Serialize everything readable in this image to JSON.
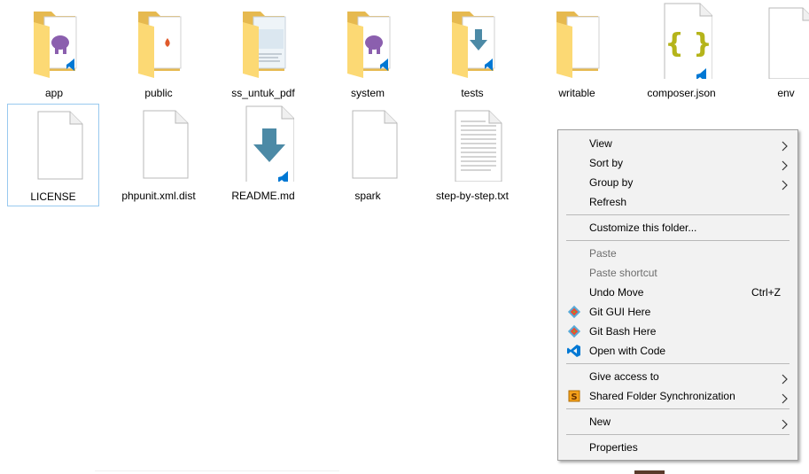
{
  "files": [
    {
      "name": "app",
      "type": "folder",
      "overlay": "elephant-vscode"
    },
    {
      "name": "public",
      "type": "folder",
      "overlay": "flame"
    },
    {
      "name": "ss_untuk_pdf",
      "type": "folder",
      "overlay": "screenshot"
    },
    {
      "name": "system",
      "type": "folder",
      "overlay": "elephant-vscode"
    },
    {
      "name": "tests",
      "type": "folder",
      "overlay": "download-vscode"
    },
    {
      "name": "writable",
      "type": "folder",
      "overlay": "blank-page"
    },
    {
      "name": "composer.json",
      "type": "file",
      "overlay": "json-braces-vscode"
    },
    {
      "name": "env",
      "type": "file",
      "overlay": "none"
    },
    {
      "name": "LICENSE",
      "type": "file",
      "overlay": "none",
      "selected": true
    },
    {
      "name": "phpunit.xml.dist",
      "type": "file",
      "overlay": "none"
    },
    {
      "name": "README.md",
      "type": "file",
      "overlay": "download-vscode"
    },
    {
      "name": "spark",
      "type": "file",
      "overlay": "none"
    },
    {
      "name": "step-by-step.txt",
      "type": "file",
      "overlay": "text-lines"
    }
  ],
  "context_menu": {
    "items": [
      {
        "label": "View",
        "submenu": true
      },
      {
        "label": "Sort by",
        "submenu": true
      },
      {
        "label": "Group by",
        "submenu": true
      },
      {
        "label": "Refresh"
      },
      {
        "label": "Customize this folder..."
      },
      {
        "label": "Paste",
        "disabled": true
      },
      {
        "label": "Paste shortcut",
        "disabled": true
      },
      {
        "label": "Undo Move",
        "shortcut": "Ctrl+Z"
      },
      {
        "label": "Git GUI Here",
        "icon": "git-icon"
      },
      {
        "label": "Git Bash Here",
        "icon": "git-icon"
      },
      {
        "label": "Open with Code",
        "icon": "vscode-icon"
      },
      {
        "label": "Give access to",
        "submenu": true
      },
      {
        "label": "Shared Folder Synchronization",
        "icon": "sync-s-icon",
        "submenu": true
      },
      {
        "label": "New",
        "submenu": true
      },
      {
        "label": "Properties"
      }
    ]
  },
  "colors": {
    "folder_back": "#e6b94f",
    "folder_front": "#fcd974",
    "selection_border": "#99c9ef",
    "menu_bg": "#f2f2f2",
    "vscode_blue": "#0078d4",
    "json_braces": "#b5b41a",
    "download_arrow": "#4c8aa6",
    "elephant": "#8b5fae"
  }
}
